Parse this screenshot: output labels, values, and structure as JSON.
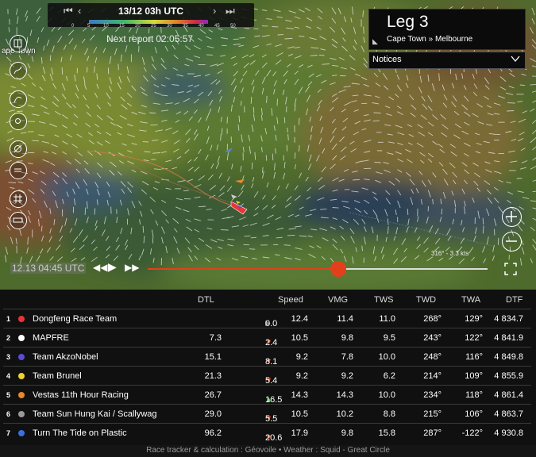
{
  "timeline": {
    "date": "13/12 03h UTC",
    "first_icon": "skip-back-icon",
    "prev_icon": "chevron-left-icon",
    "next_icon": "chevron-right-icon",
    "last_icon": "skip-forward-icon"
  },
  "wind_scale": {
    "ticks": [
      "0",
      "5",
      "10",
      "15",
      "20",
      "25",
      "30",
      "35",
      "40",
      "45",
      "50"
    ]
  },
  "next_report": {
    "label": "Next report",
    "value": "02:05:57"
  },
  "map": {
    "place_label": "ape Town"
  },
  "leg": {
    "title": "Leg 3",
    "route": "Cape Town » Melbourne"
  },
  "notices": {
    "label": "Notices"
  },
  "playback": {
    "clock": "12.13 04:45 UTC",
    "progress": 0.56,
    "wind_readout": "316° - 3.3 kts"
  },
  "table": {
    "headers": {
      "dtl": "DTL",
      "speed": "Speed",
      "vmg": "VMG",
      "tws": "TWS",
      "twd": "TWD",
      "twa": "TWA",
      "dtf": "DTF"
    },
    "rows": [
      {
        "rank": "1",
        "name": "Dongfeng Race Team",
        "color": "#e8343a",
        "dtl": "",
        "trend": "neutral",
        "change": "0.0",
        "speed": "12.4",
        "vmg": "11.4",
        "tws": "11.0",
        "twd": "268°",
        "twa": "129°",
        "dtf": "4 834.7"
      },
      {
        "rank": "2",
        "name": "MAPFRE",
        "color": "#ffffff",
        "dtl": "7.3",
        "trend": "down",
        "change": "2.4",
        "speed": "10.5",
        "vmg": "9.8",
        "tws": "9.5",
        "twd": "243°",
        "twa": "122°",
        "dtf": "4 841.9"
      },
      {
        "rank": "3",
        "name": "Team AkzoNobel",
        "color": "#5b4bd6",
        "dtl": "15.1",
        "trend": "down",
        "change": "8.1",
        "speed": "9.2",
        "vmg": "7.8",
        "tws": "10.0",
        "twd": "248°",
        "twa": "116°",
        "dtf": "4 849.8"
      },
      {
        "rank": "4",
        "name": "Team Brunel",
        "color": "#f0d32a",
        "dtl": "21.3",
        "trend": "down",
        "change": "5.4",
        "speed": "9.2",
        "vmg": "9.2",
        "tws": "6.2",
        "twd": "214°",
        "twa": "109°",
        "dtf": "4 855.9"
      },
      {
        "rank": "5",
        "name": "Vestas 11th Hour Racing",
        "color": "#e8892c",
        "dtl": "26.7",
        "trend": "up",
        "change": "16.5",
        "speed": "14.3",
        "vmg": "14.3",
        "tws": "10.0",
        "twd": "234°",
        "twa": "118°",
        "dtf": "4 861.4"
      },
      {
        "rank": "6",
        "name": "Team Sun Hung Kai / Scallywag",
        "color": "#9a9a9a",
        "dtl": "29.0",
        "trend": "down",
        "change": "5.5",
        "speed": "10.5",
        "vmg": "10.2",
        "tws": "8.8",
        "twd": "215°",
        "twa": "106°",
        "dtf": "4 863.7"
      },
      {
        "rank": "7",
        "name": "Turn The Tide on Plastic",
        "color": "#3d6fe0",
        "dtl": "96.2",
        "trend": "down",
        "change": "20.6",
        "speed": "17.9",
        "vmg": "9.8",
        "tws": "15.8",
        "twd": "287°",
        "twa": "-122°",
        "dtf": "4 930.8"
      }
    ]
  },
  "footer": "Race tracker & calculation : Géovoile • Weather : Squid - Great Circle"
}
